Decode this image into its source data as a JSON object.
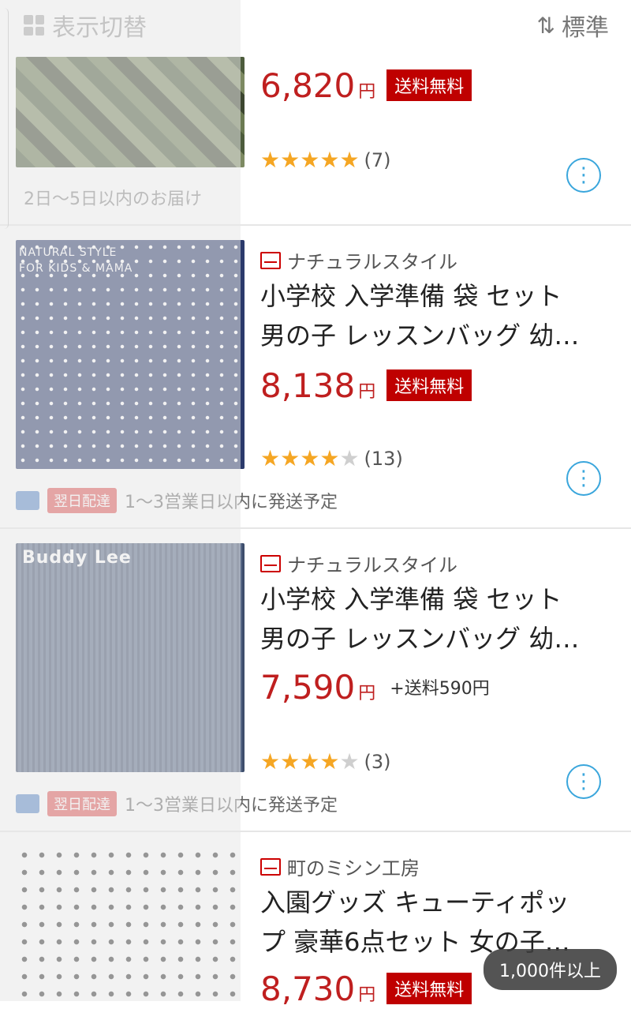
{
  "header": {
    "view_toggle_label": "表示切替",
    "sort_label": "標準"
  },
  "items": [
    {
      "price": "6,820",
      "yen": "円",
      "shipping_badge": "送料無料",
      "rating_stars": 5,
      "rating_count": "(7)",
      "delivery_text": "2日〜5日以内のお届け"
    },
    {
      "thumb_caption_1": "NATURAL STYLE",
      "thumb_caption_2": "FOR KIDS & MAMA",
      "shop": "ナチュラルスタイル",
      "title_line1": "小学校 入学準備 袋 セット",
      "title_line2": "男の子 レッスンバッグ 幼…",
      "price": "8,138",
      "yen": "円",
      "shipping_badge": "送料無料",
      "rating_stars": 4,
      "rating_count": "(13)",
      "nextday_badge": "翌日配達",
      "delivery_text": "1〜3営業日以内に発送予定"
    },
    {
      "thumb_caption_1": "Buddy Lee",
      "shop": "ナチュラルスタイル",
      "title_line1": "小学校 入学準備 袋 セット",
      "title_line2": "男の子 レッスンバッグ 幼…",
      "price": "7,590",
      "yen": "円",
      "shipping_fee": "+送料590円",
      "rating_stars": 4,
      "rating_count": "(3)",
      "nextday_badge": "翌日配達",
      "delivery_text": "1〜3営業日以内に発送予定"
    },
    {
      "shop": "町のミシン工房",
      "title_line1": "入園グッズ キューティポッ",
      "title_line2": "プ 豪華6点セット 女の子…",
      "price": "8,730",
      "yen": "円",
      "shipping_badge": "送料無料"
    }
  ],
  "result_count": "1,000件以上",
  "colors": {
    "price": "#bf1f1f",
    "badge": "#bf0000",
    "star": "#f5a623",
    "more_icon": "#3aa6dc"
  }
}
